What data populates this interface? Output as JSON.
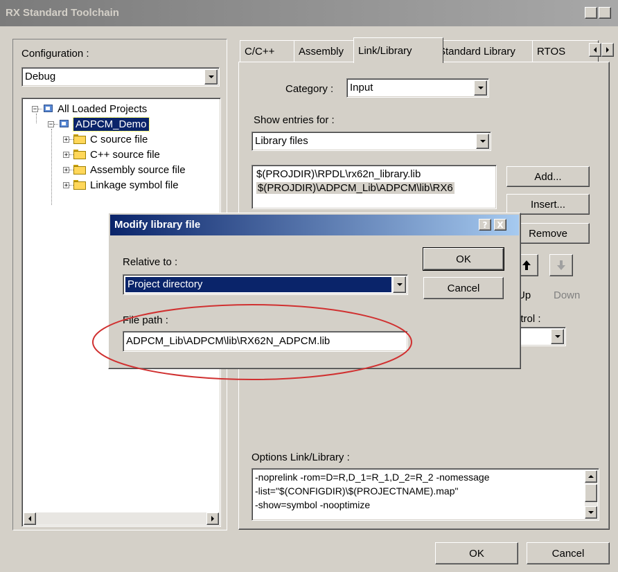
{
  "window": {
    "title": "RX Standard Toolchain",
    "help_btn": "?",
    "close_btn": "X"
  },
  "left": {
    "config_label": "Configuration :",
    "config_value": "Debug",
    "tree": {
      "root": "All Loaded Projects",
      "project": "ADPCM_Demo",
      "items": [
        "C source file",
        "C++ source file",
        "Assembly source file",
        "Linkage symbol file"
      ]
    }
  },
  "tabs": [
    "C/C++",
    "Assembly",
    "Link/Library",
    "Standard Library",
    "RTOS"
  ],
  "tabs_selected": "Link/Library",
  "page": {
    "category_label": "Category :",
    "category_value": "Input",
    "show_label": "Show entries for :",
    "show_value": "Library files",
    "library_list": [
      "$(PROJDIR)\\RPDL\\rx62n_library.lib",
      "$(PROJDIR)\\ADPCM_Lib\\ADPCM\\lib\\RX6"
    ],
    "add": "Add...",
    "insert": "Insert...",
    "remove": "Remove",
    "up": "Up",
    "down": "Down",
    "control_label": "ntrol :",
    "options_label": "Options Link/Library :",
    "options_text": "-noprelink -rom=D=R,D_1=R_1,D_2=R_2 -nomessage\n-list=\"$(CONFIGDIR)\\$(PROJECTNAME).map\"\n-show=symbol -nooptimize"
  },
  "footer": {
    "ok": "OK",
    "cancel": "Cancel"
  },
  "modal": {
    "title": "Modify library file",
    "relative_label": "Relative to :",
    "relative_value": "Project directory",
    "ok": "OK",
    "cancel": "Cancel",
    "file_path_label": "File path :",
    "file_path_value": "ADPCM_Lib\\ADPCM\\lib\\RX62N_ADPCM.lib"
  },
  "colors": {
    "selection": "#0a246a",
    "annotation": "#d03030",
    "face": "#d4d0c8"
  }
}
